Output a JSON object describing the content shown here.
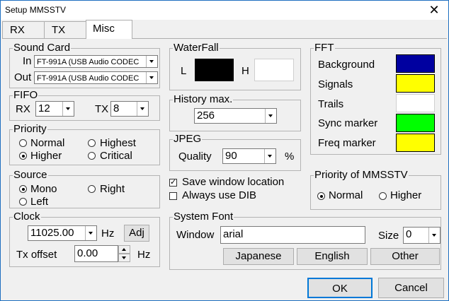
{
  "window": {
    "title": "Setup MMSSTV",
    "close_glyph": "✕"
  },
  "tabs": [
    {
      "label": "RX",
      "active": false
    },
    {
      "label": "TX",
      "active": false
    },
    {
      "label": "Misc",
      "active": true
    }
  ],
  "sound_card": {
    "legend": "Sound Card",
    "in_label": "In",
    "in_value": "FT-991A (USB Audio CODEC",
    "out_label": "Out",
    "out_value": "FT-991A (USB Audio CODEC"
  },
  "fifo": {
    "legend": "FIFO",
    "rx_label": "RX",
    "rx_value": "12",
    "tx_label": "TX",
    "tx_value": "8"
  },
  "priority": {
    "legend": "Priority",
    "options": [
      {
        "label": "Normal",
        "selected": false
      },
      {
        "label": "Highest",
        "selected": false
      },
      {
        "label": "Higher",
        "selected": true
      },
      {
        "label": "Critical",
        "selected": false
      }
    ]
  },
  "source": {
    "legend": "Source",
    "options": [
      {
        "label": "Mono",
        "selected": true
      },
      {
        "label": "Right",
        "selected": false
      },
      {
        "label": "Left",
        "selected": false
      }
    ]
  },
  "clock": {
    "legend": "Clock",
    "value": "11025.00",
    "unit": "Hz",
    "adj_label": "Adj",
    "tx_offset_label": "Tx offset",
    "tx_offset_value": "0.00",
    "tx_offset_unit": "Hz"
  },
  "waterfall": {
    "legend": "WaterFall",
    "l_label": "L",
    "h_label": "H",
    "l_color": "#000000",
    "h_color": "#ffffff"
  },
  "history": {
    "legend": "History max.",
    "value": "256"
  },
  "jpeg": {
    "legend": "JPEG",
    "quality_label": "Quality",
    "quality_value": "90",
    "unit": "%"
  },
  "options": {
    "save_window_location": {
      "label": "Save window location",
      "checked": true
    },
    "always_use_dib": {
      "label": "Always use DIB",
      "checked": false
    }
  },
  "fft": {
    "legend": "FFT",
    "items": [
      {
        "label": "Background",
        "color": "#0000a0"
      },
      {
        "label": "Signals",
        "color": "#ffff00"
      },
      {
        "label": "Trails",
        "color": "#ffffff"
      },
      {
        "label": "Sync marker",
        "color": "#00ff00"
      },
      {
        "label": "Freq marker",
        "color": "#ffff00"
      }
    ]
  },
  "priority_mmsstv": {
    "legend": "Priority of MMSSTV",
    "options": [
      {
        "label": "Normal",
        "selected": true
      },
      {
        "label": "Higher",
        "selected": false
      }
    ]
  },
  "system_font": {
    "legend": "System Font",
    "window_label": "Window",
    "window_value": "arial",
    "size_label": "Size",
    "size_value": "0",
    "buttons": {
      "japanese": "Japanese",
      "english": "English",
      "other": "Other"
    }
  },
  "footer": {
    "ok_label": "OK",
    "cancel_label": "Cancel"
  }
}
